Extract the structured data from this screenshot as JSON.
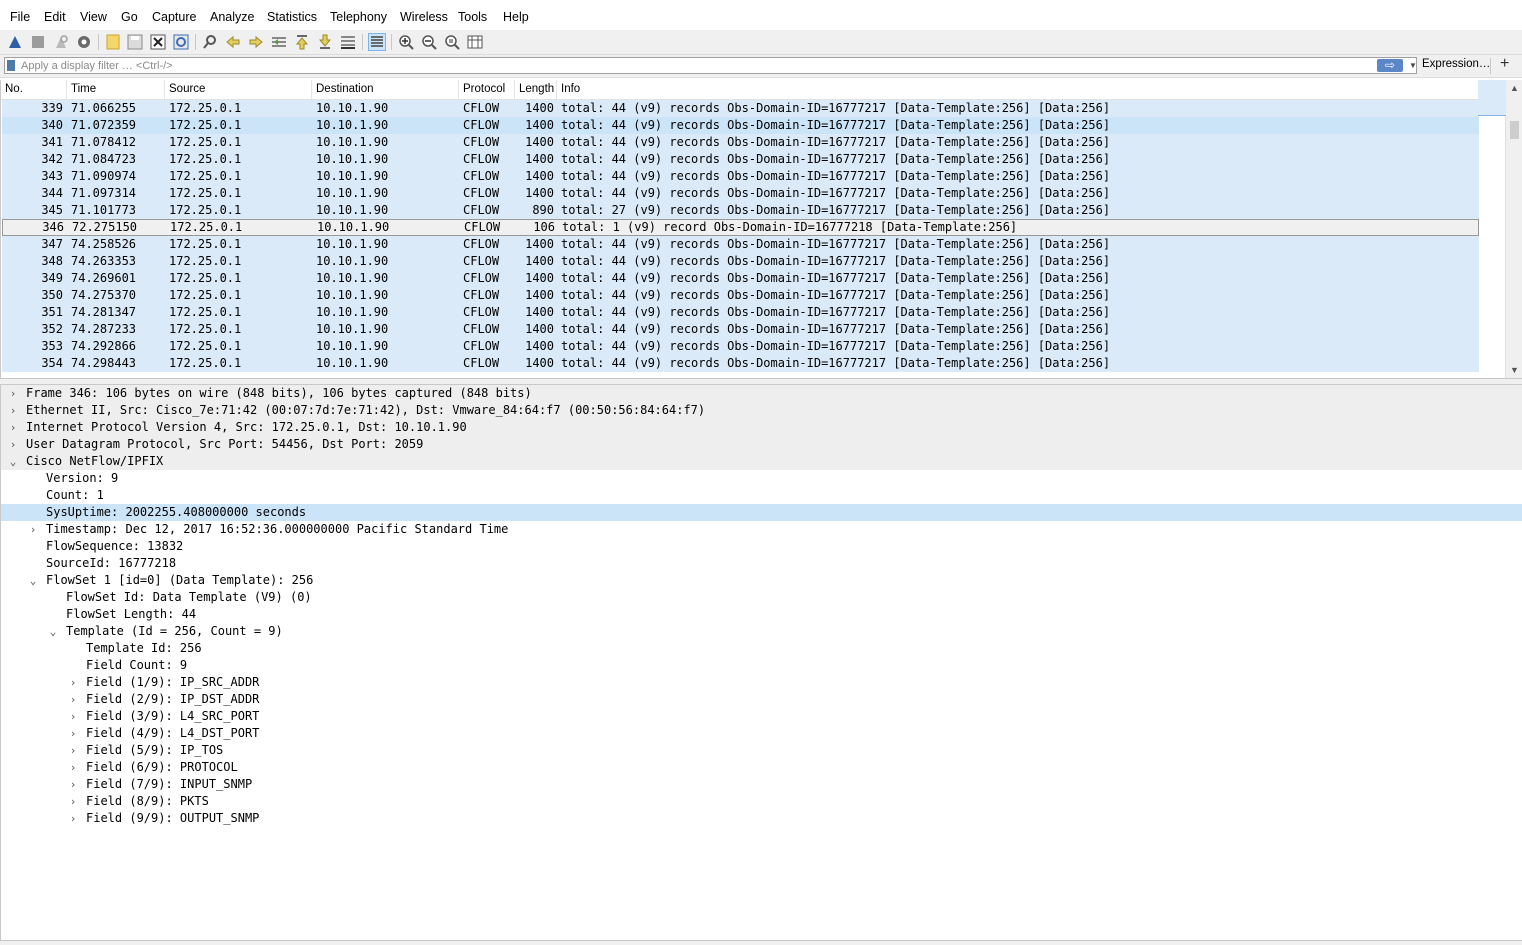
{
  "menu": [
    "File",
    "Edit",
    "View",
    "Go",
    "Capture",
    "Analyze",
    "Statistics",
    "Telephony",
    "Wireless",
    "Tools",
    "Help"
  ],
  "toolbar": {
    "icons": [
      "shark-fin-start-icon",
      "stop-icon",
      "restart-icon",
      "options-gear-icon",
      "open-file-icon",
      "save-file-icon",
      "close-file-icon",
      "reload-icon",
      "find-icon",
      "back-arrow-icon",
      "forward-arrow-icon",
      "go-to-packet-icon",
      "first-packet-icon",
      "last-packet-icon",
      "auto-scroll-icon",
      "colorize-icon",
      "zoom-in-icon",
      "zoom-out-icon",
      "normal-size-icon",
      "resize-columns-icon"
    ],
    "colorize_active": true
  },
  "filter": {
    "placeholder": "Apply a display filter … <Ctrl-/>",
    "expression_label": "Expression…",
    "add_label": "+"
  },
  "columns": [
    "No.",
    "Time",
    "Source",
    "Destination",
    "Protocol",
    "Length",
    "Info"
  ],
  "packets": [
    {
      "no": "339",
      "time": "71.066255",
      "src": "172.25.0.1",
      "dst": "10.10.1.90",
      "proto": "CFLOW",
      "len": "1400",
      "info": "total: 44 (v9) records Obs-Domain-ID=16777217 [Data-Template:256] [Data:256]"
    },
    {
      "no": "340",
      "time": "71.072359",
      "src": "172.25.0.1",
      "dst": "10.10.1.90",
      "proto": "CFLOW",
      "len": "1400",
      "info": "total: 44 (v9) records Obs-Domain-ID=16777217 [Data-Template:256] [Data:256]"
    },
    {
      "no": "341",
      "time": "71.078412",
      "src": "172.25.0.1",
      "dst": "10.10.1.90",
      "proto": "CFLOW",
      "len": "1400",
      "info": "total: 44 (v9) records Obs-Domain-ID=16777217 [Data-Template:256] [Data:256]"
    },
    {
      "no": "342",
      "time": "71.084723",
      "src": "172.25.0.1",
      "dst": "10.10.1.90",
      "proto": "CFLOW",
      "len": "1400",
      "info": "total: 44 (v9) records Obs-Domain-ID=16777217 [Data-Template:256] [Data:256]"
    },
    {
      "no": "343",
      "time": "71.090974",
      "src": "172.25.0.1",
      "dst": "10.10.1.90",
      "proto": "CFLOW",
      "len": "1400",
      "info": "total: 44 (v9) records Obs-Domain-ID=16777217 [Data-Template:256] [Data:256]"
    },
    {
      "no": "344",
      "time": "71.097314",
      "src": "172.25.0.1",
      "dst": "10.10.1.90",
      "proto": "CFLOW",
      "len": "1400",
      "info": "total: 44 (v9) records Obs-Domain-ID=16777217 [Data-Template:256] [Data:256]"
    },
    {
      "no": "345",
      "time": "71.101773",
      "src": "172.25.0.1",
      "dst": "10.10.1.90",
      "proto": "CFLOW",
      "len": "890",
      "info": "total: 27 (v9) records Obs-Domain-ID=16777217 [Data-Template:256] [Data:256]"
    },
    {
      "no": "346",
      "time": "72.275150",
      "src": "172.25.0.1",
      "dst": "10.10.1.90",
      "proto": "CFLOW",
      "len": "106",
      "info": "total: 1 (v9) record Obs-Domain-ID=16777218 [Data-Template:256]"
    },
    {
      "no": "347",
      "time": "74.258526",
      "src": "172.25.0.1",
      "dst": "10.10.1.90",
      "proto": "CFLOW",
      "len": "1400",
      "info": "total: 44 (v9) records Obs-Domain-ID=16777217 [Data-Template:256] [Data:256]"
    },
    {
      "no": "348",
      "time": "74.263353",
      "src": "172.25.0.1",
      "dst": "10.10.1.90",
      "proto": "CFLOW",
      "len": "1400",
      "info": "total: 44 (v9) records Obs-Domain-ID=16777217 [Data-Template:256] [Data:256]"
    },
    {
      "no": "349",
      "time": "74.269601",
      "src": "172.25.0.1",
      "dst": "10.10.1.90",
      "proto": "CFLOW",
      "len": "1400",
      "info": "total: 44 (v9) records Obs-Domain-ID=16777217 [Data-Template:256] [Data:256]"
    },
    {
      "no": "350",
      "time": "74.275370",
      "src": "172.25.0.1",
      "dst": "10.10.1.90",
      "proto": "CFLOW",
      "len": "1400",
      "info": "total: 44 (v9) records Obs-Domain-ID=16777217 [Data-Template:256] [Data:256]"
    },
    {
      "no": "351",
      "time": "74.281347",
      "src": "172.25.0.1",
      "dst": "10.10.1.90",
      "proto": "CFLOW",
      "len": "1400",
      "info": "total: 44 (v9) records Obs-Domain-ID=16777217 [Data-Template:256] [Data:256]"
    },
    {
      "no": "352",
      "time": "74.287233",
      "src": "172.25.0.1",
      "dst": "10.10.1.90",
      "proto": "CFLOW",
      "len": "1400",
      "info": "total: 44 (v9) records Obs-Domain-ID=16777217 [Data-Template:256] [Data:256]"
    },
    {
      "no": "353",
      "time": "74.292866",
      "src": "172.25.0.1",
      "dst": "10.10.1.90",
      "proto": "CFLOW",
      "len": "1400",
      "info": "total: 44 (v9) records Obs-Domain-ID=16777217 [Data-Template:256] [Data:256]"
    },
    {
      "no": "354",
      "time": "74.298443",
      "src": "172.25.0.1",
      "dst": "10.10.1.90",
      "proto": "CFLOW",
      "len": "1400",
      "info": "total: 44 (v9) records Obs-Domain-ID=16777217 [Data-Template:256] [Data:256]"
    }
  ],
  "selected_packet": "346",
  "details": [
    {
      "level": 0,
      "toggle": "collapsed",
      "text": "Frame 346: 106 bytes on wire (848 bits), 106 bytes captured (848 bits)",
      "style": "grey"
    },
    {
      "level": 0,
      "toggle": "collapsed",
      "text": "Ethernet II, Src: Cisco_7e:71:42 (00:07:7d:7e:71:42), Dst: Vmware_84:64:f7 (00:50:56:84:64:f7)",
      "style": "grey"
    },
    {
      "level": 0,
      "toggle": "collapsed",
      "text": "Internet Protocol Version 4, Src: 172.25.0.1, Dst: 10.10.1.90",
      "style": "grey"
    },
    {
      "level": 0,
      "toggle": "collapsed",
      "text": "User Datagram Protocol, Src Port: 54456, Dst Port: 2059",
      "style": "grey"
    },
    {
      "level": 0,
      "toggle": "expanded",
      "text": "Cisco NetFlow/IPFIX",
      "style": "grey"
    },
    {
      "level": 1,
      "toggle": "none",
      "text": "Version: 9",
      "style": ""
    },
    {
      "level": 1,
      "toggle": "none",
      "text": "Count: 1",
      "style": ""
    },
    {
      "level": 1,
      "toggle": "none",
      "text": "SysUptime: 2002255.408000000 seconds",
      "style": "sel"
    },
    {
      "level": 1,
      "toggle": "collapsed",
      "text": "Timestamp: Dec 12, 2017 16:52:36.000000000 Pacific Standard Time",
      "style": ""
    },
    {
      "level": 1,
      "toggle": "none",
      "text": "FlowSequence: 13832",
      "style": ""
    },
    {
      "level": 1,
      "toggle": "none",
      "text": "SourceId: 16777218",
      "style": ""
    },
    {
      "level": 1,
      "toggle": "expanded",
      "text": "FlowSet 1 [id=0] (Data Template): 256",
      "style": ""
    },
    {
      "level": 2,
      "toggle": "none",
      "text": "FlowSet Id: Data Template (V9) (0)",
      "style": ""
    },
    {
      "level": 2,
      "toggle": "none",
      "text": "FlowSet Length: 44",
      "style": ""
    },
    {
      "level": 2,
      "toggle": "expanded",
      "text": "Template (Id = 256, Count = 9)",
      "style": ""
    },
    {
      "level": 3,
      "toggle": "none",
      "text": "Template Id: 256",
      "style": ""
    },
    {
      "level": 3,
      "toggle": "none",
      "text": "Field Count: 9",
      "style": ""
    },
    {
      "level": 3,
      "toggle": "collapsed",
      "text": "Field (1/9): IP_SRC_ADDR",
      "style": ""
    },
    {
      "level": 3,
      "toggle": "collapsed",
      "text": "Field (2/9): IP_DST_ADDR",
      "style": ""
    },
    {
      "level": 3,
      "toggle": "collapsed",
      "text": "Field (3/9): L4_SRC_PORT",
      "style": ""
    },
    {
      "level": 3,
      "toggle": "collapsed",
      "text": "Field (4/9): L4_DST_PORT",
      "style": ""
    },
    {
      "level": 3,
      "toggle": "collapsed",
      "text": "Field (5/9): IP_TOS",
      "style": ""
    },
    {
      "level": 3,
      "toggle": "collapsed",
      "text": "Field (6/9): PROTOCOL",
      "style": ""
    },
    {
      "level": 3,
      "toggle": "collapsed",
      "text": "Field (7/9): INPUT_SNMP",
      "style": ""
    },
    {
      "level": 3,
      "toggle": "collapsed",
      "text": "Field (8/9): PKTS",
      "style": ""
    },
    {
      "level": 3,
      "toggle": "collapsed",
      "text": "Field (9/9): OUTPUT_SNMP",
      "style": ""
    }
  ],
  "colors": {
    "row_bg": "#dbeaf8",
    "selected_bg": "#cce4f7",
    "tree_header_bg": "#eeeeee"
  }
}
